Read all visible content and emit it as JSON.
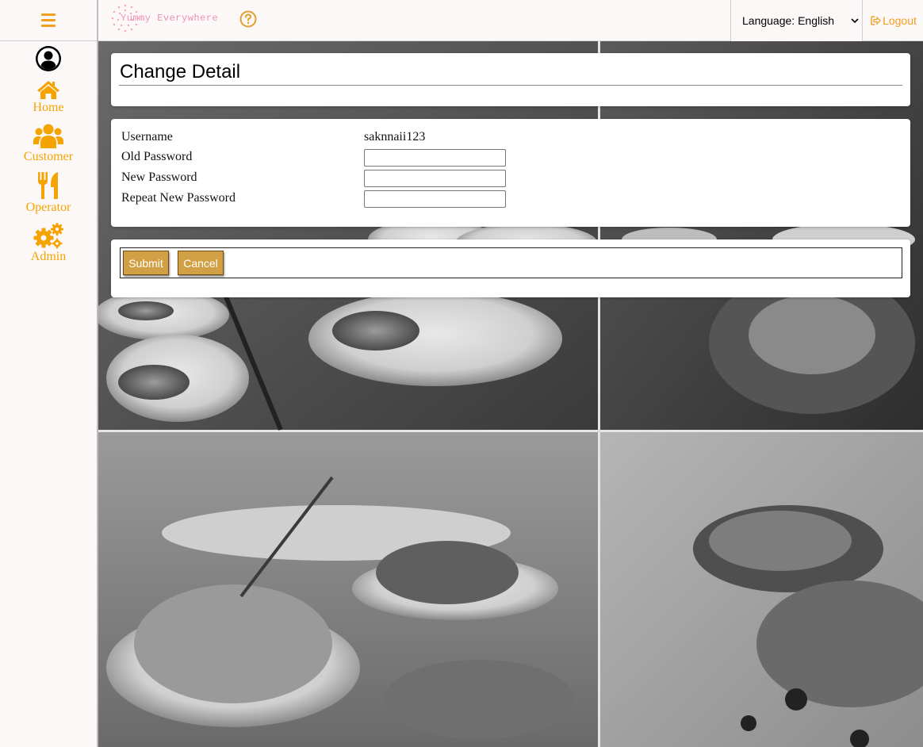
{
  "app": {
    "logo_text": "Yummy Everywhere",
    "accent": "#f5a300",
    "logo_color": "#f08fb0",
    "button_color": "#d1a045"
  },
  "sidebar": {
    "menu_icon": "hamburger-icon",
    "profile_icon": "user-circle-icon",
    "items": [
      {
        "label": "Home",
        "icon": "home-icon"
      },
      {
        "label": "Customer",
        "icon": "users-icon"
      },
      {
        "label": "Operator",
        "icon": "utensils-icon"
      },
      {
        "label": "Admin",
        "icon": "cogs-icon"
      }
    ]
  },
  "header": {
    "help_icon": "question-circle-icon",
    "language": "Language: English",
    "logout_label": "Logout"
  },
  "page": {
    "title": "Change Detail"
  },
  "form": {
    "username_label": "Username",
    "username_value": "saknnaii123",
    "old_password_label": "Old Password",
    "old_password_value": "",
    "new_password_label": "New Password",
    "new_password_value": "",
    "repeat_password_label": "Repeat New Password",
    "repeat_password_value": ""
  },
  "actions": {
    "submit_label": "Submit",
    "cancel_label": "Cancel"
  }
}
